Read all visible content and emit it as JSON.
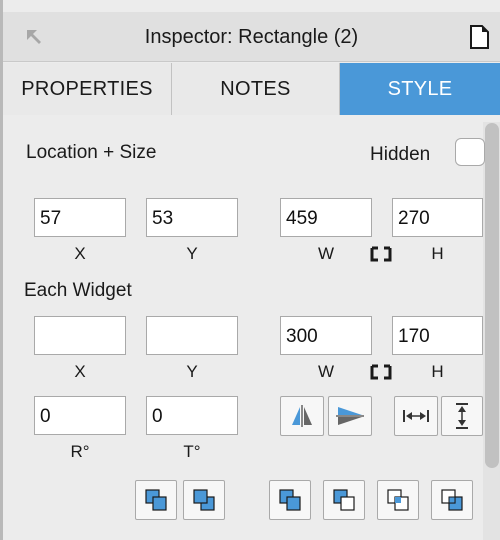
{
  "window": {
    "title": "Inspector: Rectangle (2)",
    "back_icon": "arrow-up-left-icon",
    "doc_icon": "document-icon"
  },
  "tabs": [
    {
      "label": "PROPERTIES",
      "selected": false
    },
    {
      "label": "NOTES",
      "selected": false
    },
    {
      "label": "STYLE",
      "selected": true
    }
  ],
  "colors": {
    "accent": "#4a98d8",
    "icon_blue": "#4a98d8"
  },
  "location_size": {
    "heading": "Location + Size",
    "hidden_label": "Hidden",
    "hidden_checked": false,
    "x": "57",
    "y": "53",
    "w": "459",
    "h": "270",
    "x_label": "X",
    "y_label": "Y",
    "w_label": "W",
    "h_label": "H"
  },
  "each_widget": {
    "heading": "Each Widget",
    "x": "",
    "y": "",
    "w": "300",
    "h": "170",
    "x_label": "X",
    "y_label": "Y",
    "w_label": "W",
    "h_label": "H",
    "r": "0",
    "t": "0",
    "r_label": "R°",
    "t_label": "T°"
  },
  "transform_buttons": [
    "flip-horizontal-icon",
    "flip-vertical-icon",
    "distribute-horizontal-icon",
    "distribute-vertical-icon"
  ],
  "arrange_buttons": [
    "bring-forward-icon",
    "send-backward-icon",
    "bring-to-front-icon",
    "send-to-back-icon",
    "group-icon",
    "ungroup-icon"
  ]
}
